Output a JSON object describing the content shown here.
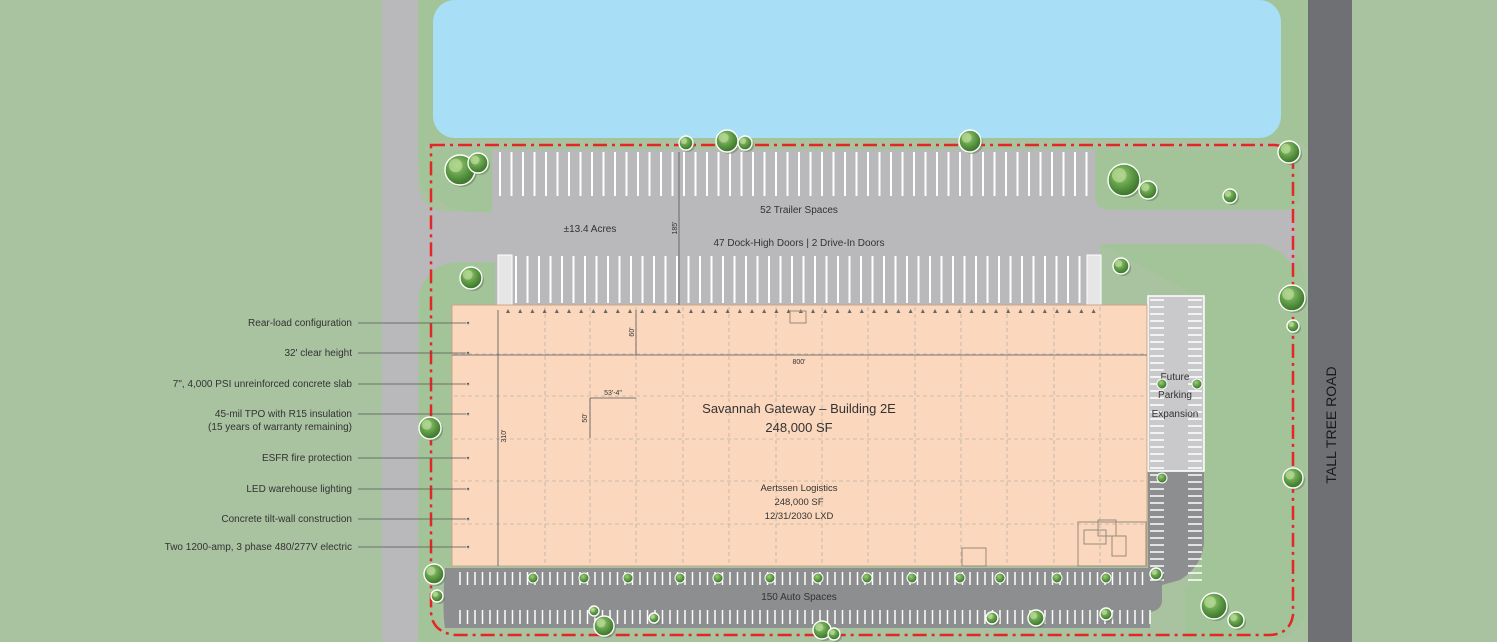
{
  "site": {
    "building_title": "Savannah Gateway – Building 2E",
    "building_sf": "248,000 SF",
    "tenant": {
      "name": "Aertssen Logistics",
      "sf": "248,000 SF",
      "lxd": "12/31/2030 LXD"
    },
    "acres": "±13.4 Acres",
    "trailer_spaces": "52 Trailer Spaces",
    "doors": "47 Dock-High Doors | 2 Drive-In Doors",
    "auto_spaces": "150 Auto Spaces",
    "road_name": "TALL TREE ROAD",
    "future_parking": [
      "Future",
      "Parking",
      "Expansion"
    ],
    "dimensions": {
      "width": "800'",
      "depth": "310'",
      "truck_court": "185'",
      "dock_depth": "60'",
      "bay_width": "53'-4\"",
      "bay_depth": "50'"
    }
  },
  "features": [
    "Rear-load configuration",
    "32' clear height",
    "7\", 4,000 PSI unreinforced concrete slab",
    [
      "45-mil TPO with R15 insulation",
      "(15 years of warranty remaining)"
    ],
    "ESFR fire protection",
    "LED warehouse lighting",
    "Concrete tilt-wall construction",
    "Two 1200-amp, 3 phase 480/277V electric"
  ],
  "colors": {
    "grass": "#a9c2a0",
    "pond": "#a8dff7",
    "pavement": "#b9b9bb",
    "asphalt": "#8d8e90",
    "road": "#6f7073",
    "building": "#fbd8bd",
    "property_line": "#e32626",
    "tree": "#5f9b46"
  }
}
